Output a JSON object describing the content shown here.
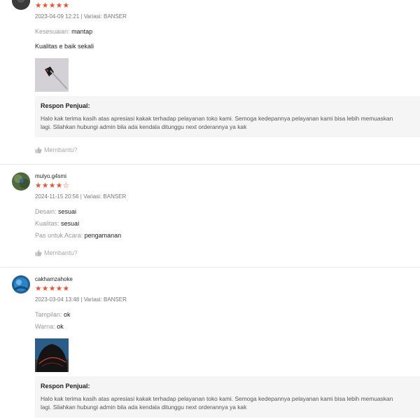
{
  "colors": {
    "star": "#ee4d2d",
    "response_bg": "#f5f5f5",
    "divider": "#e8e8e8"
  },
  "reviews": [
    {
      "username": "",
      "rating": 5,
      "stars": "★★★★★",
      "meta": "2023-04-09 12:21 | Variasi: BANSER",
      "attrs": [
        {
          "label": "Kesesuaian:",
          "value": "mantap"
        }
      ],
      "comment": "Kualitas e baik sekali",
      "has_photo": true,
      "response": {
        "title": "Respon Penjual:",
        "text": "Halo kak terima kasih atas apresiasi kakak terhadap pelayanan toko kami. Semoga kedepannya pelayanan kami bisa lebih memuaskan lagi. Silahkan hubungi admin bila ada kendala ditunggu next orderannya ya kak"
      },
      "helpful": "Membantu?"
    },
    {
      "username": "mulyo.g4smi",
      "rating": 4,
      "stars": "★★★★",
      "empty_stars": "☆",
      "meta": "2024-11-15 20:56 | Variasi: BANSER",
      "attrs": [
        {
          "label": "Desain:",
          "value": "sesuai"
        },
        {
          "label": "Kualitas:",
          "value": "sesuai"
        },
        {
          "label": "Pas untuk Acara:",
          "value": "pengamanan"
        }
      ],
      "helpful": "Membantu?"
    },
    {
      "username": "cakhamzahoke",
      "rating": 5,
      "stars": "★★★★★",
      "meta": "2023-03-04 13:48 | Variasi: BANSER",
      "attrs": [
        {
          "label": "Tampilan:",
          "value": "ok"
        },
        {
          "label": "Warna:",
          "value": "ok"
        }
      ],
      "has_photo": true,
      "response": {
        "title": "Respon Penjual:",
        "text": "Halo kak terima kasih atas apresiasi kakak terhadap pelayanan toko kami. Semoga kedepannya pelayanan kami bisa lebih memuaskan lagi. Silahkan hubungi admin bila ada kendala ditunggu next orderannya ya kak"
      }
    }
  ]
}
